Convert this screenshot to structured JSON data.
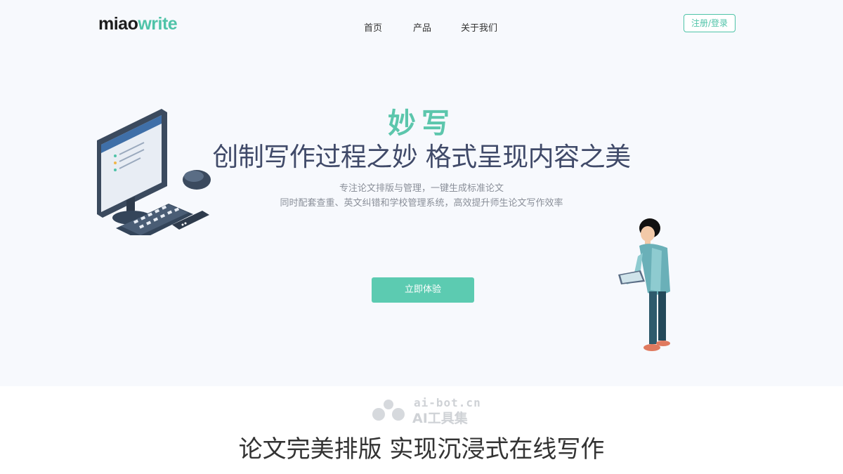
{
  "header": {
    "logo": {
      "part1": "miao",
      "part2": "write"
    },
    "nav": [
      {
        "label": "首页"
      },
      {
        "label": "产品"
      },
      {
        "label": "关于我们"
      }
    ],
    "login_label": "注册/登录"
  },
  "hero": {
    "title": "妙写",
    "subtitle": "创制写作过程之妙 格式呈现内容之美",
    "desc_line1": "专注论文排版与管理，一键生成标准论文",
    "desc_line2": "同时配套查重、英文纠错和学校管理系统，高效提升师生论文写作效率",
    "cta_label": "立即体验"
  },
  "watermark": {
    "site": "ai-bot.cn",
    "brand": "AI工具集"
  },
  "section": {
    "title": "论文完美排版 实现沉浸式在线写作"
  },
  "colors": {
    "accent": "#5ccbb1",
    "heading": "#404a69",
    "background": "#f7f9fd"
  }
}
